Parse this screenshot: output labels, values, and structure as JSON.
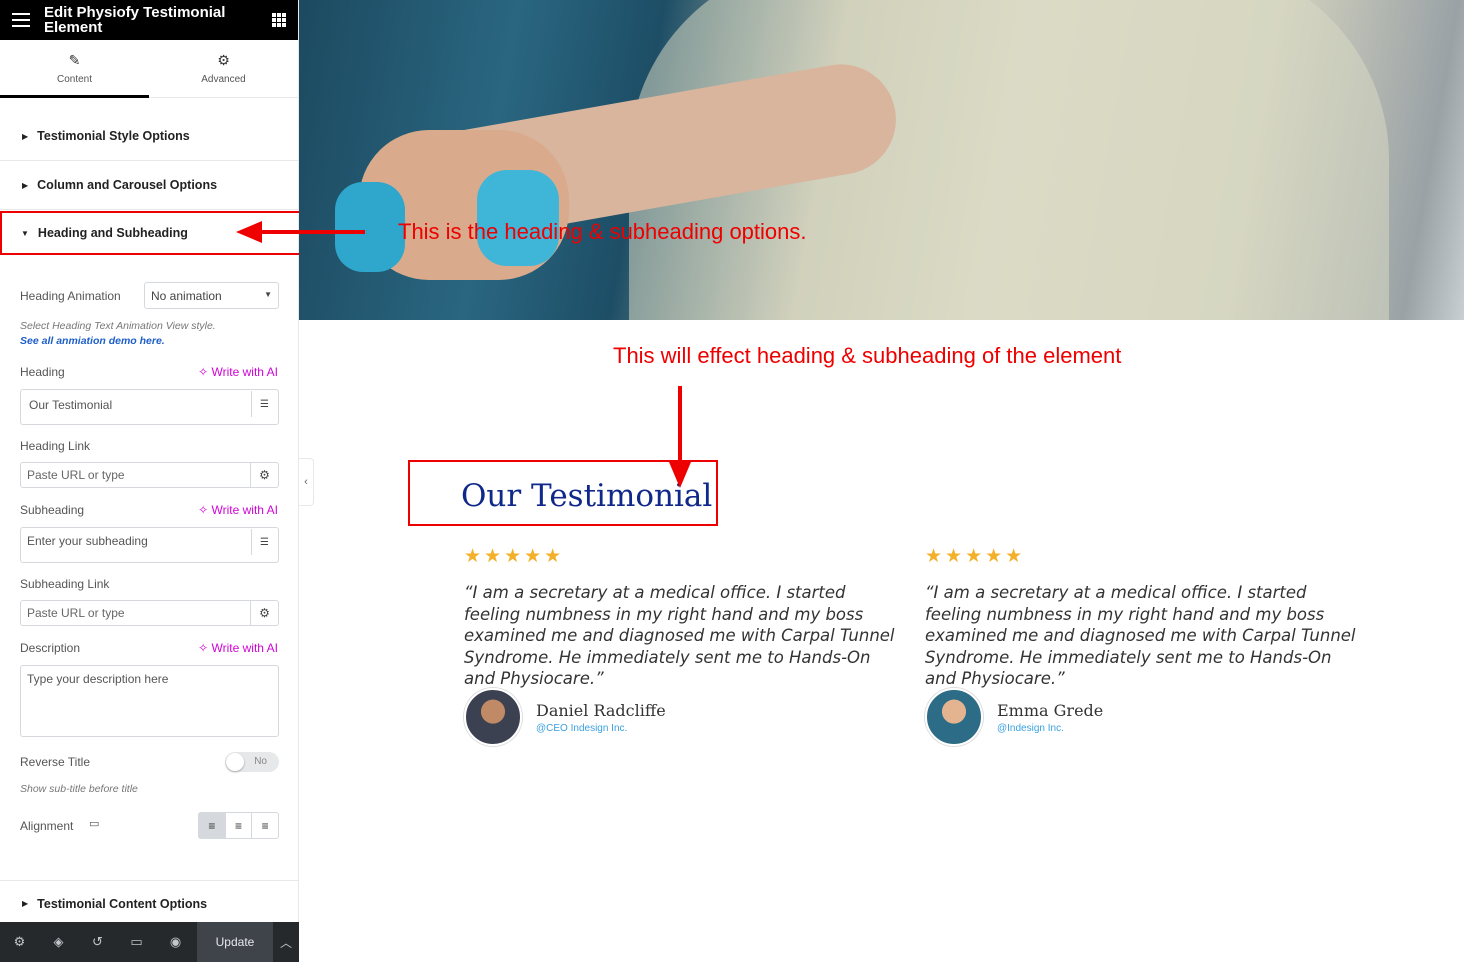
{
  "topbar": {
    "title": "Edit Physiofy Testimonial Element"
  },
  "tabs": [
    {
      "label": "Content",
      "icon": "pencil-icon"
    },
    {
      "label": "Advanced",
      "icon": "gear-icon"
    }
  ],
  "sections": {
    "style": "Testimonial Style Options",
    "column": "Column and Carousel Options",
    "heading": "Heading and Subheading",
    "content": "Testimonial Content Options"
  },
  "controls": {
    "heading_animation": {
      "label": "Heading Animation",
      "value": "No animation"
    },
    "animation_hint": "Select Heading Text Animation View style.",
    "animation_link": "See all anmiation demo here.",
    "heading": {
      "label": "Heading",
      "value": "Our Testimonial"
    },
    "write_ai": "Write with AI",
    "heading_link": {
      "label": "Heading Link",
      "placeholder": "Paste URL or type"
    },
    "subheading": {
      "label": "Subheading",
      "placeholder": "Enter your subheading"
    },
    "subheading_link": {
      "label": "Subheading Link",
      "placeholder": "Paste URL or type"
    },
    "description": {
      "label": "Description",
      "placeholder": "Type your description here"
    },
    "reverse_title": {
      "label": "Reverse Title",
      "state": "No",
      "hint": "Show sub-title before title"
    },
    "alignment": {
      "label": "Alignment",
      "selected": "left"
    }
  },
  "bottombar": {
    "update_label": "Update"
  },
  "annotations": {
    "options_note": "This is the heading & subheading options.",
    "effect_note": "This will effect heading & subheading of the element"
  },
  "preview": {
    "heading": "Our Testimonial",
    "stars": "★★★★★",
    "rating": 5,
    "testimonials": [
      {
        "quote": "“I am a secretary at a medical office. I started feeling numbness in my right hand and my boss examined me and diagnosed me with Carpal Tunnel Syndrome. He immediately sent me to Hands-On and Physiocare.”",
        "name": "Daniel Radcliffe",
        "role": "@CEO Indesign Inc."
      },
      {
        "quote": "“I am a secretary at a medical office. I started feeling numbness in my right hand and my boss examined me and diagnosed me with Carpal Tunnel Syndrome. He immediately sent me to Hands-On and Physiocare.”",
        "name": "Emma Grede",
        "role": "@Indesign Inc."
      }
    ]
  },
  "colors": {
    "annotation": "#e00000",
    "heading": "#10288a",
    "stars": "#f3b12b",
    "ai": "#d004d4"
  }
}
